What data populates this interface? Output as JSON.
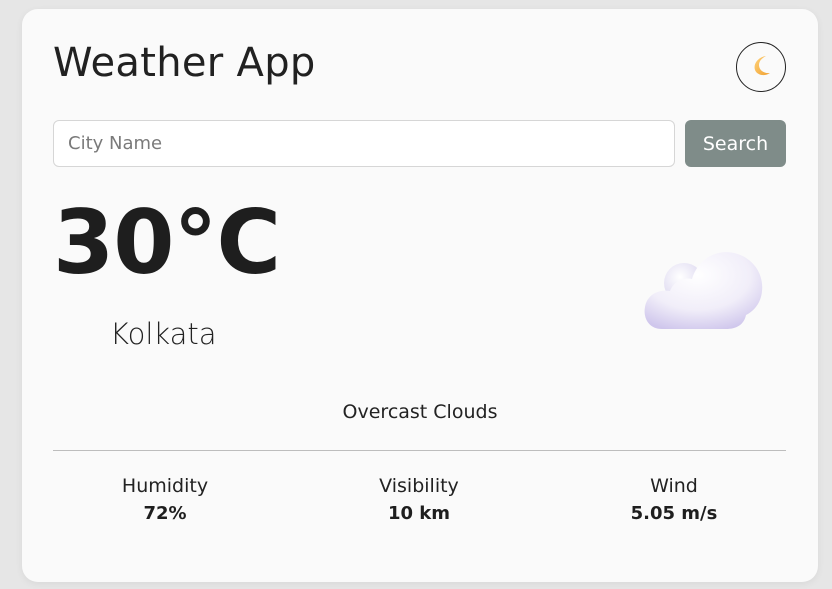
{
  "app": {
    "title": "Weather App"
  },
  "theme_toggle": {
    "icon": "crescent-moon-icon"
  },
  "search": {
    "placeholder": "City Name",
    "value": "",
    "button_label": "Search"
  },
  "current": {
    "temperature": "30°C",
    "city": "Kolkata",
    "condition": "Overcast Clouds",
    "icon": "cloud-icon"
  },
  "stats": {
    "humidity": {
      "label": "Humidity",
      "value": "72%"
    },
    "visibility": {
      "label": "Visibility",
      "value": "10 km"
    },
    "wind": {
      "label": "Wind",
      "value": "5.05 m/s"
    }
  },
  "colors": {
    "card_background": "#fafafa",
    "page_background": "#e6e6e6",
    "search_button": "#7f8c89",
    "text": "#212121"
  }
}
